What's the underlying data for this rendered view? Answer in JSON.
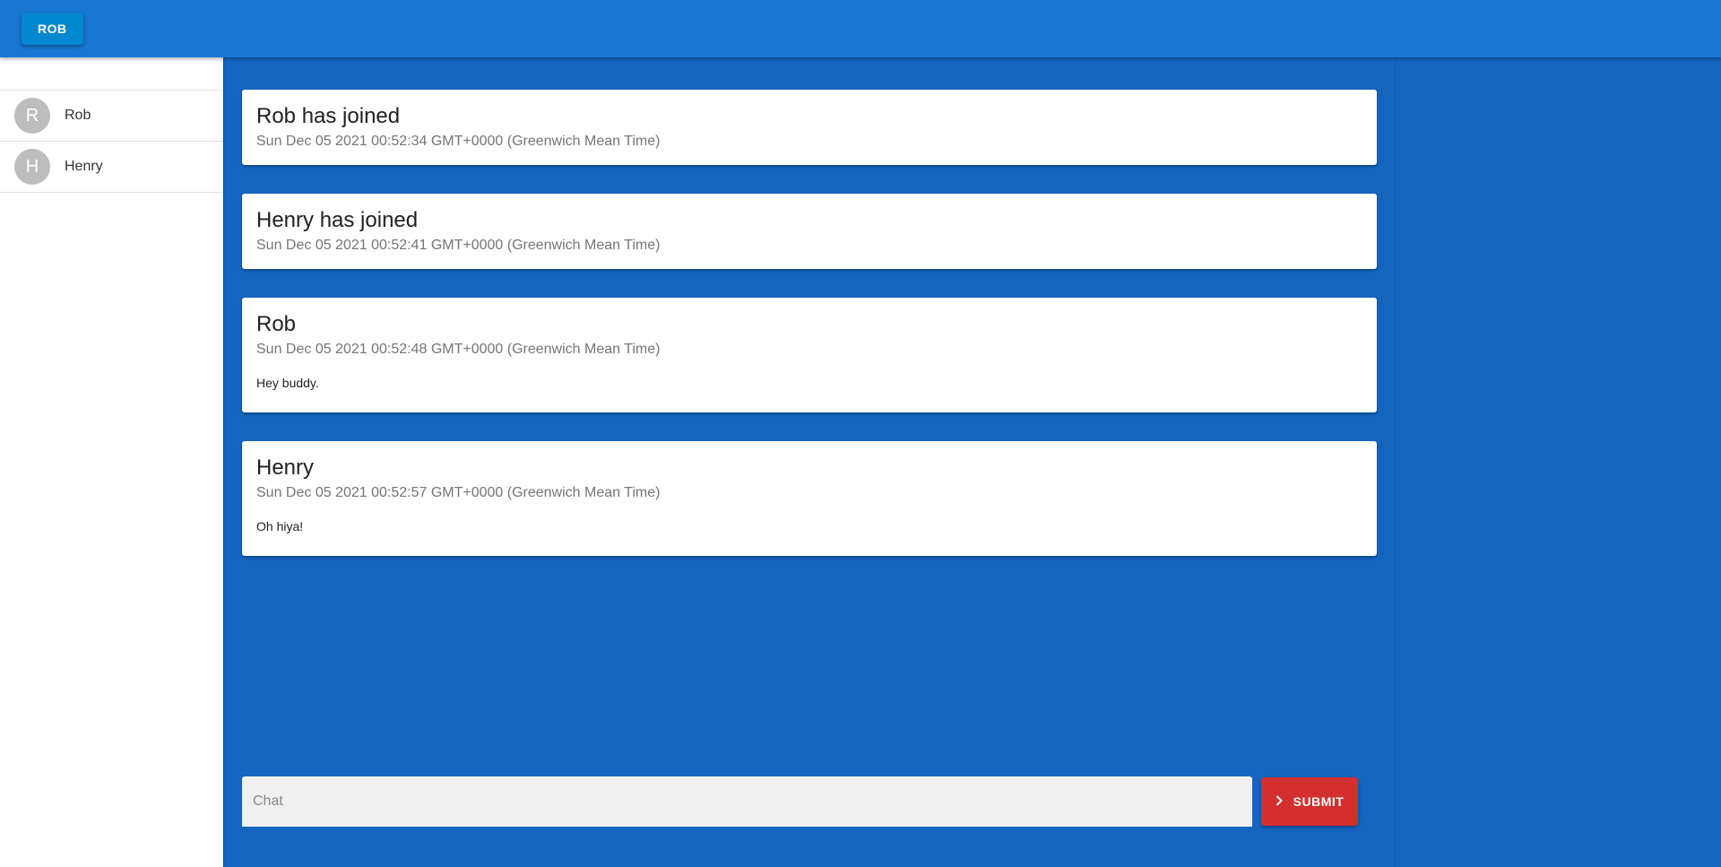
{
  "header": {
    "user_button": "ROB"
  },
  "sidebar": {
    "users": [
      {
        "initial": "R",
        "name": "Rob"
      },
      {
        "initial": "H",
        "name": "Henry"
      }
    ]
  },
  "messages": [
    {
      "title": "Rob has joined",
      "time": "Sun Dec 05 2021 00:52:34 GMT+0000 (Greenwich Mean Time)",
      "text": ""
    },
    {
      "title": "Henry has joined",
      "time": "Sun Dec 05 2021 00:52:41 GMT+0000 (Greenwich Mean Time)",
      "text": ""
    },
    {
      "title": "Rob",
      "time": "Sun Dec 05 2021 00:52:48 GMT+0000 (Greenwich Mean Time)",
      "text": "Hey buddy."
    },
    {
      "title": "Henry",
      "time": "Sun Dec 05 2021 00:52:57 GMT+0000 (Greenwich Mean Time)",
      "text": "Oh hiya!"
    }
  ],
  "composer": {
    "placeholder": "Chat",
    "value": "",
    "submit_label": "SUBMIT",
    "submit_icon": "chevron-right-icon"
  },
  "colors": {
    "app_bar": "#1976d2",
    "background": "#1565c0",
    "user_button": "#0288d1",
    "submit": "#d32f2f",
    "avatar": "#bdbdbd"
  }
}
